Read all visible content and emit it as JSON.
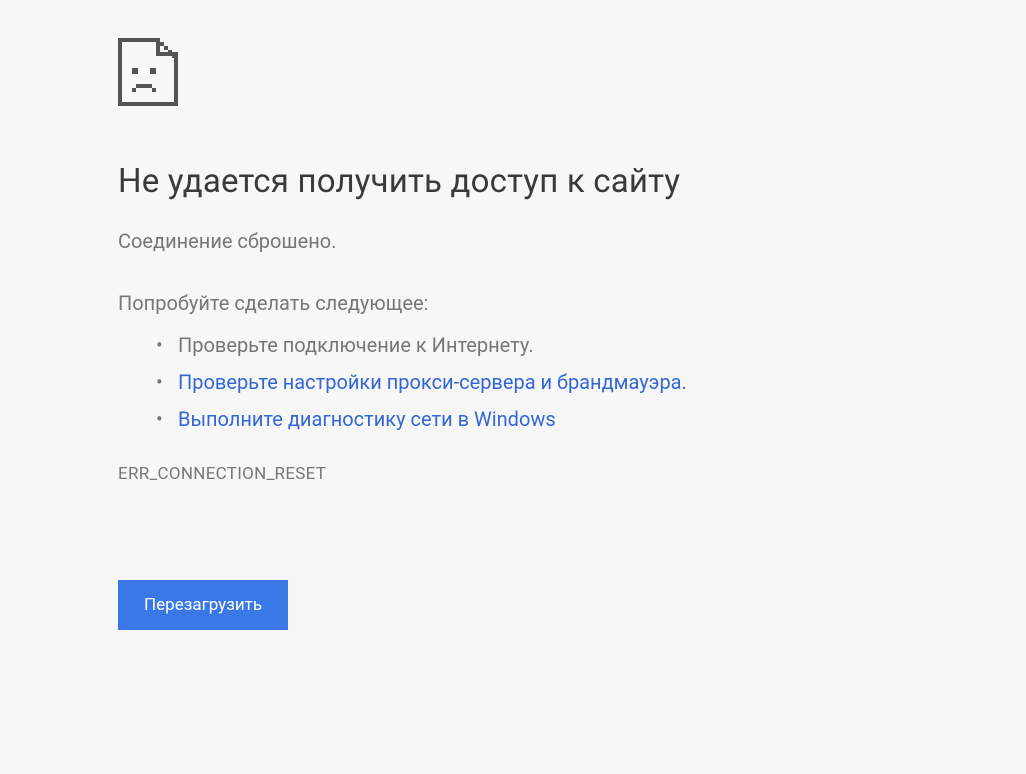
{
  "heading": "Не удается получить доступ к сайту",
  "subtitle": "Соединение сброшено.",
  "try_heading": "Попробуйте сделать следующее:",
  "suggestions": {
    "item1": "Проверьте подключение к Интернету.",
    "item2": "Проверьте настройки прокси-сервера и брандмауэра.",
    "item3": "Выполните диагностику сети в Windows"
  },
  "error_code": "ERR_CONNECTION_RESET",
  "reload_label": "Перезагрузить"
}
